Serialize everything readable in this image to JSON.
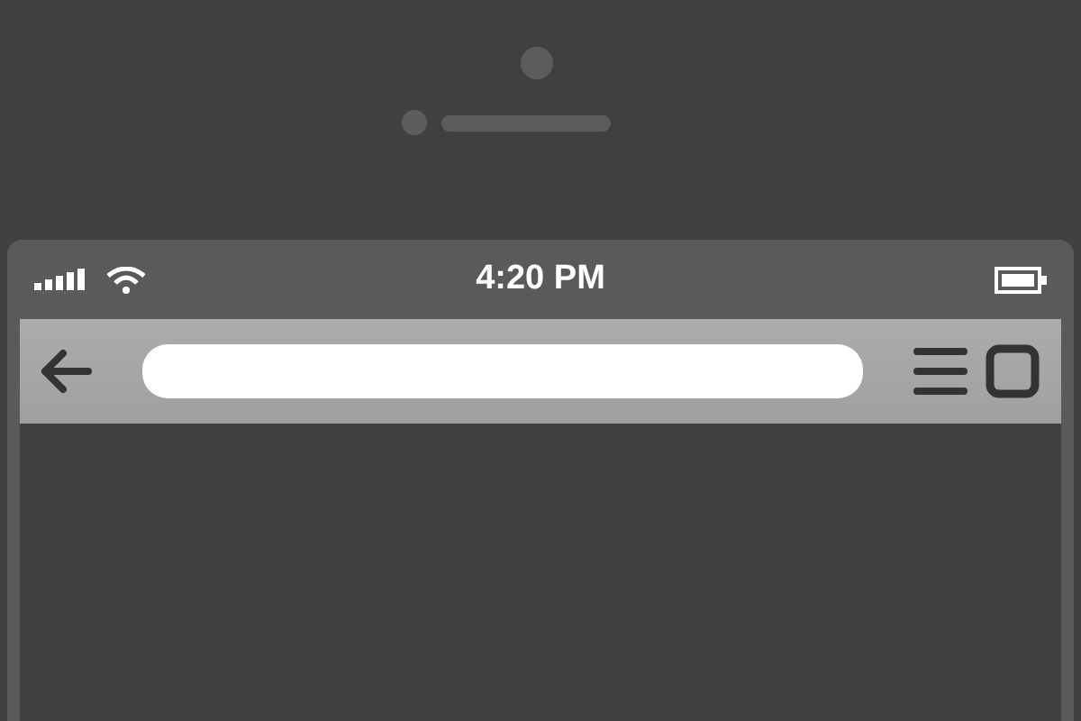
{
  "status_bar": {
    "time": "4:20 PM"
  }
}
